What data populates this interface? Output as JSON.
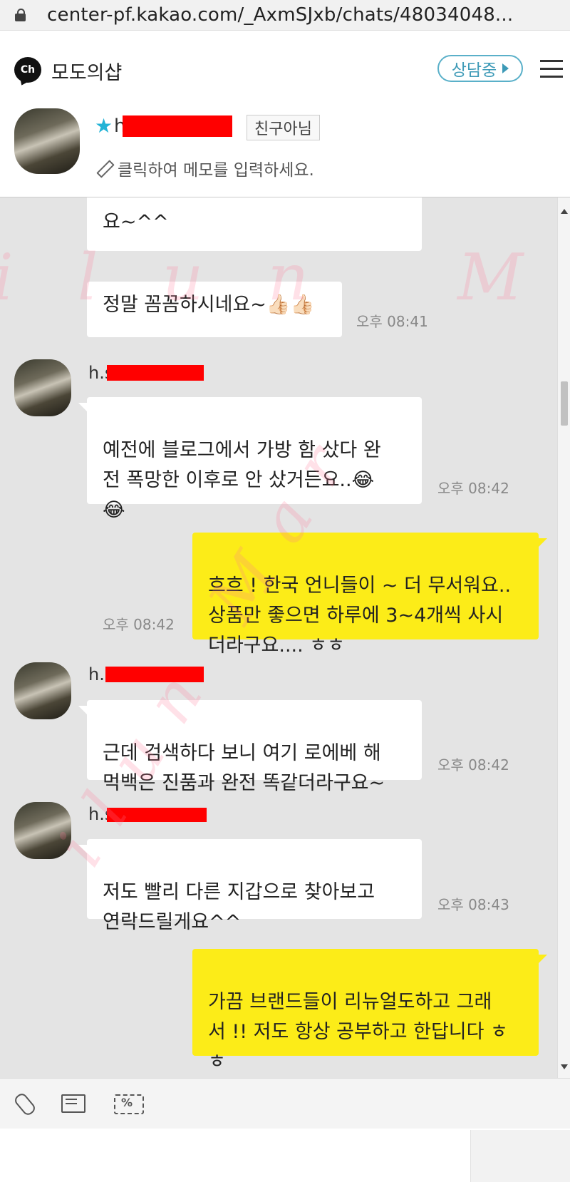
{
  "browser": {
    "url": "center-pf.kakao.com/_AxmSJxb/chats/48034048..."
  },
  "channel": {
    "logo_text": "Ch",
    "name": "모도의샵",
    "status_label": "상담중"
  },
  "profile": {
    "name_visible": "h",
    "friend_badge": "친구아님",
    "memo_placeholder": "클릭하여 메모를 입력하세요."
  },
  "messages": [
    {
      "id": "m0",
      "side": "in",
      "text": "요~^^",
      "time": ""
    },
    {
      "id": "m1",
      "side": "in",
      "text": "정말 꼼꼼하시네요~👍🏻👍🏻",
      "time": "오후 08:41"
    },
    {
      "id": "m2",
      "side": "in",
      "sender": "h.s",
      "text": "예전에 블로그에서 가방 함 샀다 완\n전 폭망한 이후로 안 샀거든요..😂\n😂",
      "time": "오후 08:42"
    },
    {
      "id": "m3",
      "side": "out",
      "text": "흐흐 ! 한국 언니들이 ~ 더 무서워요..\n상품만 좋으면 하루에 3~4개씩 사시\n더라구요.... ㅎㅎ",
      "time": "오후 08:42"
    },
    {
      "id": "m4",
      "side": "in",
      "sender": "h.",
      "text": "근데 검색하다 보니 여기 로에베 해\n먹백은 진품과 완전 똑같더라구요~",
      "time": "오후 08:42"
    },
    {
      "id": "m5",
      "side": "in",
      "sender": "h.s",
      "text": "저도 빨리 다른 지갑으로 찾아보고\n연락드릴게요^^",
      "time": "오후 08:43"
    },
    {
      "id": "m6",
      "side": "out",
      "text": "가끔 브랜드들이 리뉴얼도하고 그래\n서 !! 저도 항상 공부하고 한답니다 ㅎ\nㅎ",
      "time": ""
    }
  ],
  "watermark": "ilun Mar"
}
